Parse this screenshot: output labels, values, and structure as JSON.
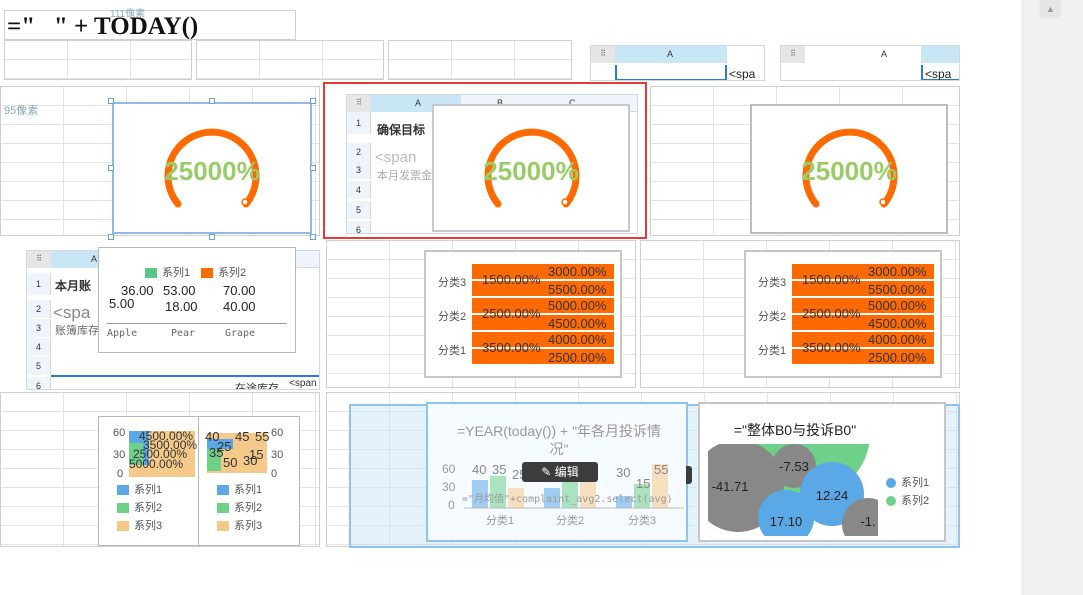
{
  "formula_bar": {
    "text": "=\"   \" + TODAY()",
    "hint": "111像素"
  },
  "side_ruler": {
    "label": "95像素"
  },
  "gauges": [
    {
      "value_label": "25000%"
    },
    {
      "value_label": "25000%"
    },
    {
      "value_label": "25000%"
    }
  ],
  "sheet_top_a": {
    "col": "A",
    "partial": "<spa"
  },
  "sheet_top_b": {
    "col": "A",
    "partial": "<spa"
  },
  "sheet_mid": {
    "cols": [
      "A",
      "B",
      "C"
    ],
    "rows": [
      "1",
      "2",
      "3",
      "4",
      "5",
      "6"
    ],
    "cells": [
      "确保目标",
      "<span",
      "本月发票金"
    ]
  },
  "sheet_left": {
    "col": "A",
    "rows": [
      "1",
      "2",
      "3",
      "4",
      "5",
      "6"
    ],
    "cells": [
      "本月账",
      "<spa",
      "账簿库存"
    ],
    "footer": "在途库存",
    "footer_right": "<span"
  },
  "legend_chart": {
    "legend": [
      "系列1",
      "系列2"
    ],
    "rows": [
      [
        "36.00",
        "53.00",
        "70.00"
      ],
      [
        "5.00",
        "18.00",
        "40.00"
      ]
    ],
    "categories": [
      "Apple",
      "Pear",
      "Grape"
    ],
    "colors": {
      "s1": "#57c785",
      "s2": "#ff6a00"
    }
  },
  "bar_chart_a": {
    "categories": [
      "分类3",
      "分类2",
      "分类1"
    ],
    "labels": [
      [
        "1500.00%",
        "3000.00%",
        "5500.00%"
      ],
      [
        "2500.00%",
        "5000.00%",
        "4500.00%"
      ],
      [
        "3500.00%",
        "4000.00%",
        "2500.00%"
      ]
    ]
  },
  "bar_chart_b": {
    "categories": [
      "分类3",
      "分类2",
      "分类1"
    ],
    "labels": [
      [
        "1500.00%",
        "3000.00%",
        "5500.00%"
      ],
      [
        "2500.00%",
        "5000.00%",
        "4500.00%"
      ],
      [
        "3500.00%",
        "4000.00%",
        "2500.00%"
      ]
    ]
  },
  "stack_chart_a": {
    "axis": [
      "60",
      "30",
      "0"
    ],
    "overlay": [
      "4500.00%",
      "3500.00%",
      "2500.00%",
      "5000.00%"
    ],
    "legend": [
      "系列1",
      "系列2",
      "系列3"
    ]
  },
  "stack_chart_b": {
    "axis": [
      "60",
      "30",
      "0"
    ],
    "top_labels": [
      "40",
      "45",
      "55"
    ],
    "mid_labels": [
      "25",
      "35",
      "15"
    ],
    "low_labels": [
      "50",
      "30"
    ],
    "legend": [
      "系列1",
      "系列2",
      "系列3"
    ]
  },
  "year_chart": {
    "title": "=YEAR(today()) + \"年各月投诉情况\"",
    "axis": [
      "60",
      "30",
      "0"
    ],
    "categories": [
      "分类1",
      "分类2",
      "分类3"
    ],
    "bar_labels": [
      "40",
      "35",
      "25",
      "30",
      "15",
      "55"
    ],
    "formula": "=\"月均值\"+complaint_avg2.select(avg)",
    "edit_label": "编辑"
  },
  "bubble_chart": {
    "title": "=\"整体B0与投诉B0\"",
    "labels": [
      "-7.53",
      "-41.71",
      "12.24",
      "17.10",
      "-1."
    ],
    "legend": [
      "系列1",
      "系列2"
    ],
    "colors": {
      "s1": "#5aa8e6",
      "s2": "#6fd08a",
      "gray": "#888888"
    }
  },
  "chart_data": {
    "type": "bar",
    "title": "",
    "categories": [
      "分类1",
      "分类2",
      "分类3"
    ],
    "series": [
      {
        "name": "系列1",
        "values": [
          35,
          25,
          15
        ]
      },
      {
        "name": "系列2",
        "values": [
          40,
          45,
          30
        ]
      },
      {
        "name": "系列3",
        "values": [
          25,
          50,
          55
        ]
      }
    ],
    "ylim": [
      0,
      60
    ]
  }
}
